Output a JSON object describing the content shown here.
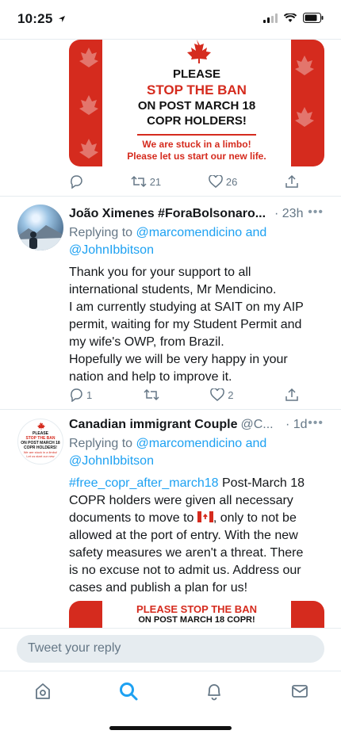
{
  "status": {
    "time": "10:25"
  },
  "tweet1": {
    "banner": {
      "line1": "PLEASE",
      "line2": "STOP THE BAN",
      "line3": "ON POST MARCH 18",
      "line4": "COPR HOLDERS!",
      "sub1": "We are stuck in a limbo!",
      "sub2": "Please let us start our new life."
    },
    "retweets": "21",
    "likes": "26"
  },
  "tweet2": {
    "name": "João Ximenes #ForaBolsonaro...",
    "time": "· 23h",
    "replying_to": "Replying to",
    "mention1": "@marcomendicino",
    "and": "and",
    "mention2": "@JohnIbbitson",
    "body": [
      "Thank you for your support to all",
      "international students, Mr Mendicino.",
      "I am currently studying at SAIT on my AIP",
      "permit, waiting for my Student Permit and",
      "my wife's OWP, from Brazil.",
      "Hopefully we will be very happy in your",
      "nation and help to improve it."
    ],
    "replies": "1",
    "likes": "2"
  },
  "tweet3": {
    "name": "Canadian immigrant Couple",
    "handle": "@C...",
    "time": "· 1d",
    "replying_to": "Replying to",
    "mention1": "@marcomendicino",
    "and": "and",
    "mention2": "@JohnIbbitson",
    "hashtag": "#free_copr_after_march18",
    "body_start": " Post-March 18",
    "body_line2": "COPR holders were given all necessary",
    "body_line3a": "documents to move to",
    "body_line3b": ", only to not be",
    "body_rest": [
      "allowed at the port of entry. With the new",
      "safety measures we aren't a threat. There",
      "is no excuse not to admit us. Address our",
      "cases and publish a plan for us!"
    ],
    "avatar_text": [
      "PLEASE",
      "STOP THE BAN",
      "ON POST MARCH 18",
      "COPR HOLDERS!",
      "We are stuck in a limbo!",
      "Let us start our new"
    ],
    "banner": {
      "line1": "PLEASE STOP THE BAN",
      "line2": "ON POST MARCH 18 COPR!"
    }
  },
  "compose": {
    "placeholder": "Tweet your reply"
  },
  "colors": {
    "accent": "#1da1f2",
    "canada_red": "#d52b1e",
    "muted": "#657786"
  }
}
